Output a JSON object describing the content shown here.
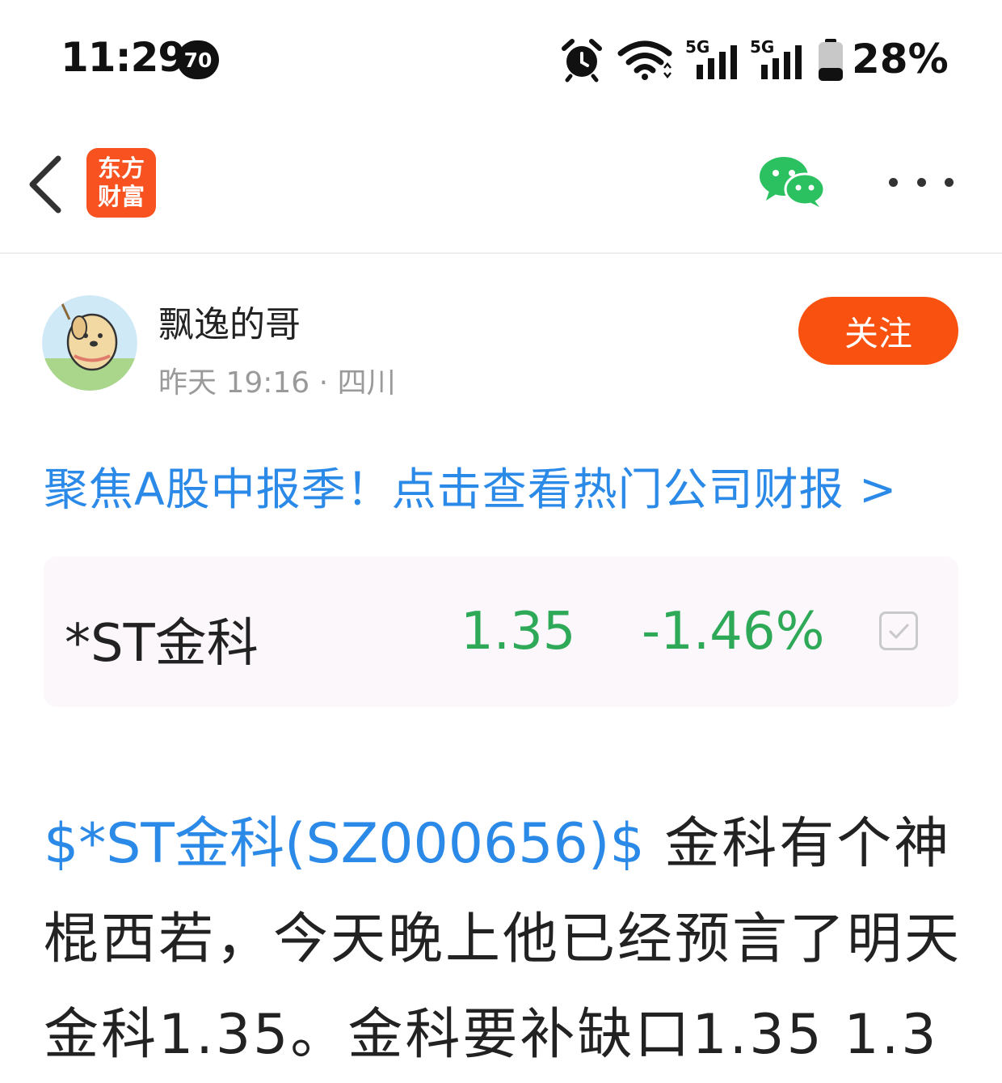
{
  "status_bar": {
    "time": "11:29",
    "notification_count": "70",
    "battery_percent": "28%",
    "network_1": "5G",
    "network_2": "5G"
  },
  "nav": {
    "logo_line1": "东方",
    "logo_line2": "财富",
    "brand_color": "#f7521f"
  },
  "author": {
    "name": "飘逸的哥",
    "time": "昨天 19:16",
    "separator": "·",
    "location": "四川",
    "follow_label": "关注"
  },
  "promo": {
    "text": "聚焦A股中报季！点击查看热门公司财报 >"
  },
  "stock": {
    "name": "*ST金科",
    "price": "1.35",
    "change": "-1.46%",
    "down_color": "#2ea957"
  },
  "post": {
    "stock_tag": "$*ST金科(SZ000656)$",
    "text": " 金科有个神棍西若，今天晚上他已经预言了明天金科1.35。金科要补缺口1.35 1.3"
  }
}
